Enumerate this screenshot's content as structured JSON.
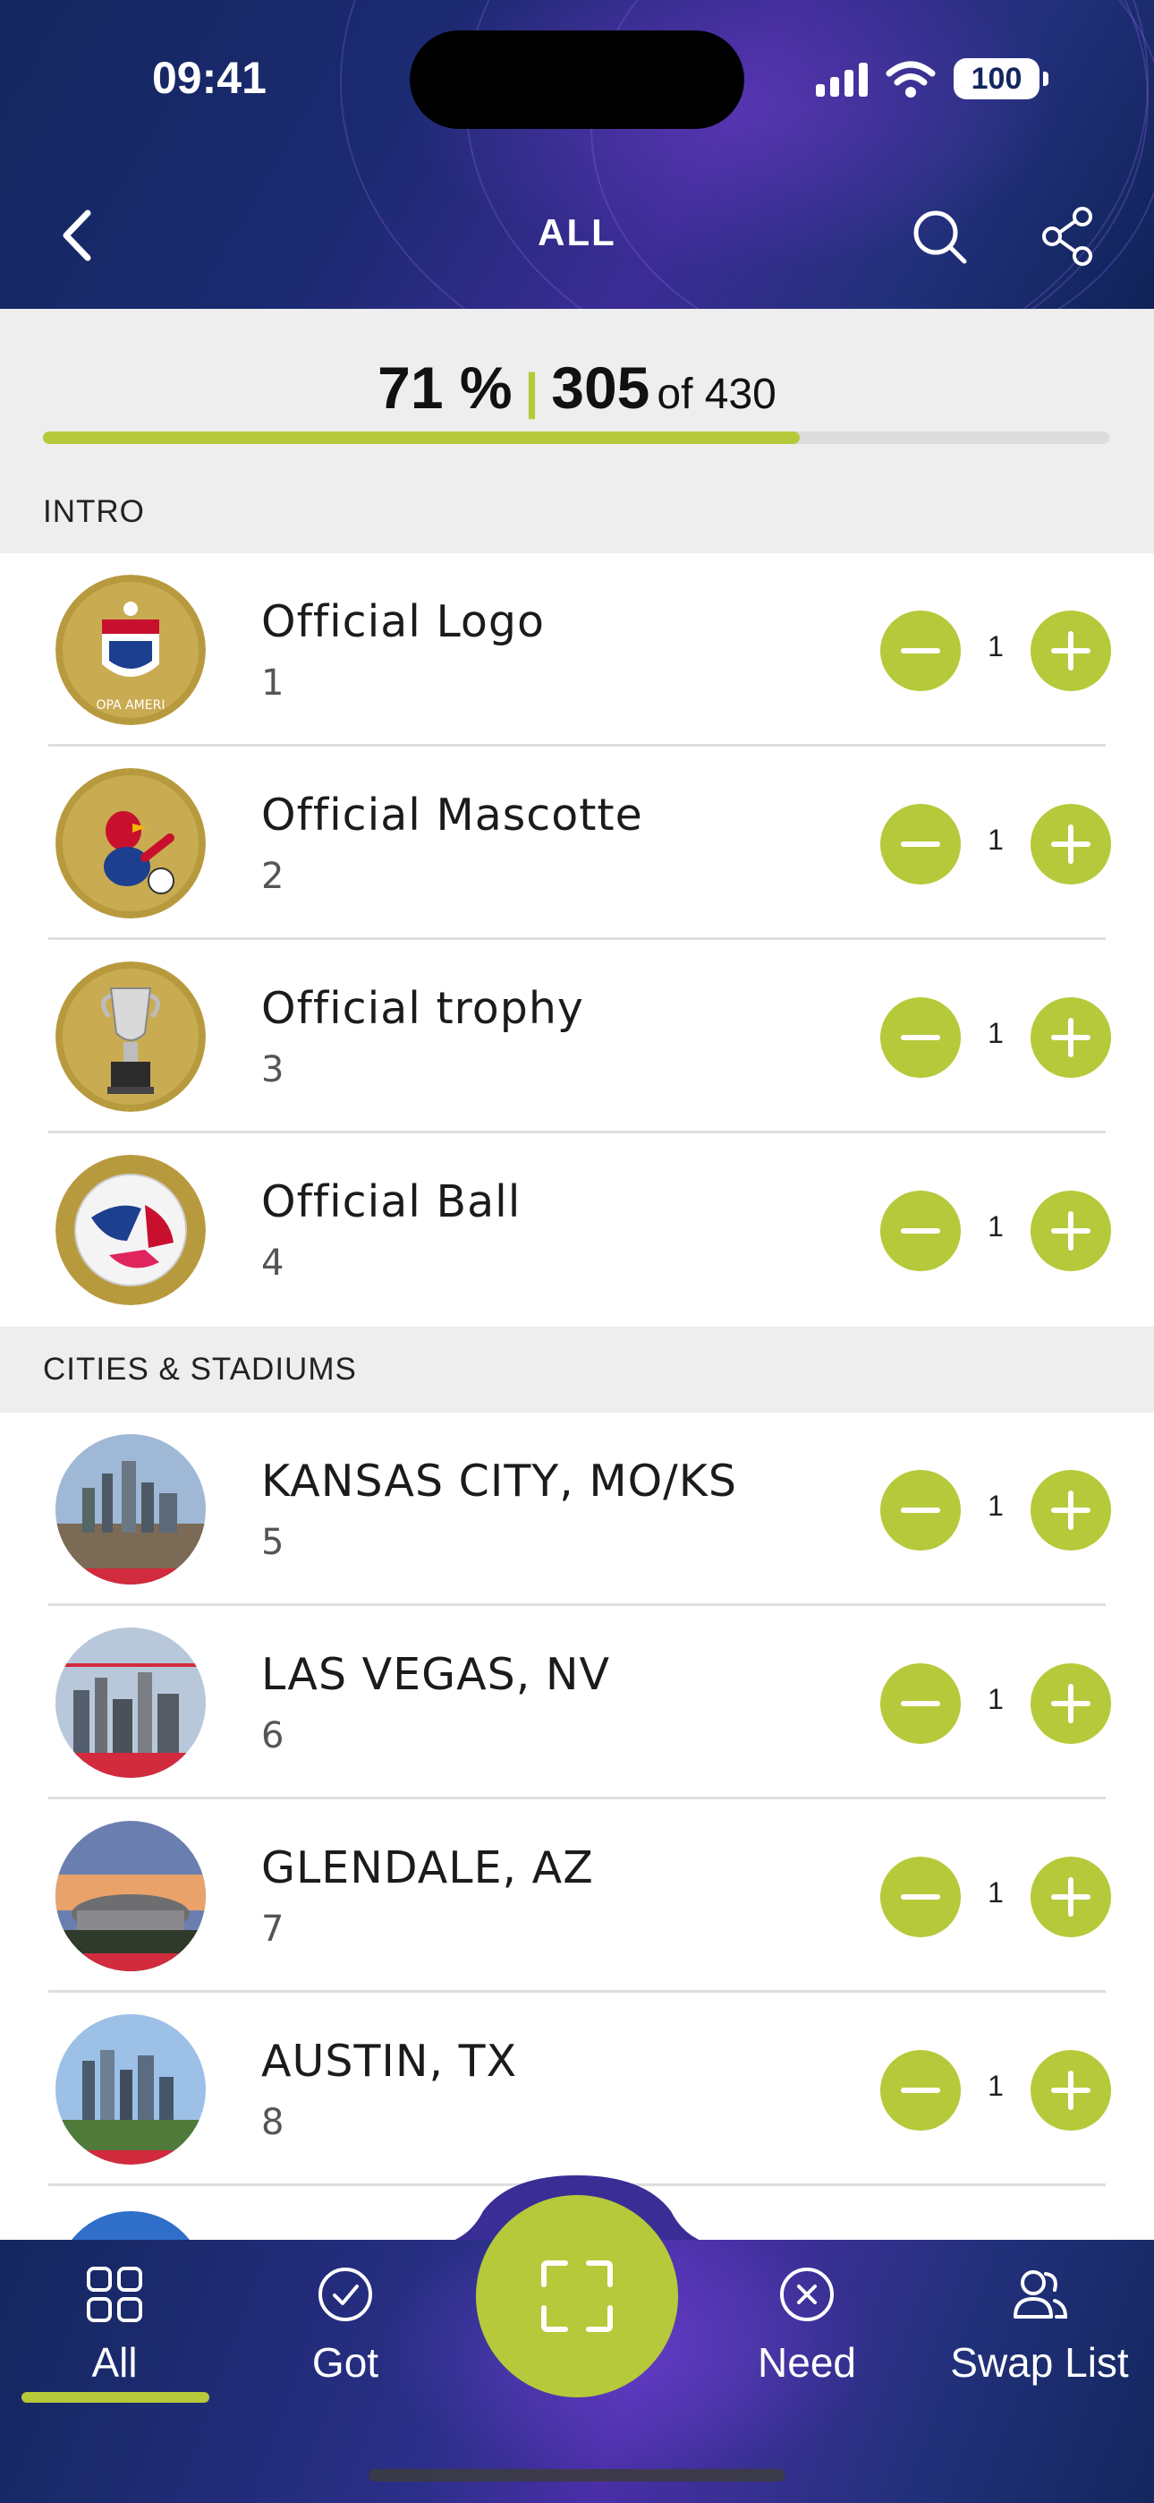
{
  "status_bar": {
    "time": "09:41",
    "battery": "100"
  },
  "nav": {
    "title": "ALL"
  },
  "progress": {
    "percent_label": "71 %",
    "separator": "|",
    "owned": "305",
    "total_label": "of 430",
    "fraction": 0.71
  },
  "colors": {
    "accent": "#b6c93a",
    "header": "#13275e",
    "section_bg": "#eeeeee"
  },
  "sections": [
    {
      "title": "INTRO"
    },
    {
      "title": "CITIES & STADIUMS"
    }
  ],
  "items": [
    {
      "name": "Official Logo",
      "number": "1",
      "qty": "1",
      "thumb": "logo-thumbnail"
    },
    {
      "name": "Official Mascotte",
      "number": "2",
      "qty": "1",
      "thumb": "mascot-thumbnail"
    },
    {
      "name": "Official trophy",
      "number": "3",
      "qty": "1",
      "thumb": "trophy-thumbnail"
    },
    {
      "name": "Official Ball",
      "number": "4",
      "qty": "1",
      "thumb": "ball-thumbnail"
    },
    {
      "name": "KANSAS CITY, MO/KS",
      "number": "5",
      "qty": "1",
      "thumb": "city-thumbnail"
    },
    {
      "name": "LAS VEGAS, NV",
      "number": "6",
      "qty": "1",
      "thumb": "city-thumbnail"
    },
    {
      "name": "GLENDALE, AZ",
      "number": "7",
      "qty": "1",
      "thumb": "stadium-thumbnail"
    },
    {
      "name": "AUSTIN, TX",
      "number": "8",
      "qty": "1",
      "thumb": "city-thumbnail"
    }
  ],
  "tabs": [
    {
      "label": "All",
      "icon": "grid-icon",
      "active": true
    },
    {
      "label": "Got",
      "icon": "check-circle-icon"
    },
    {
      "label": "Need",
      "icon": "x-circle-icon"
    },
    {
      "label": "Swap List",
      "icon": "users-icon"
    }
  ]
}
